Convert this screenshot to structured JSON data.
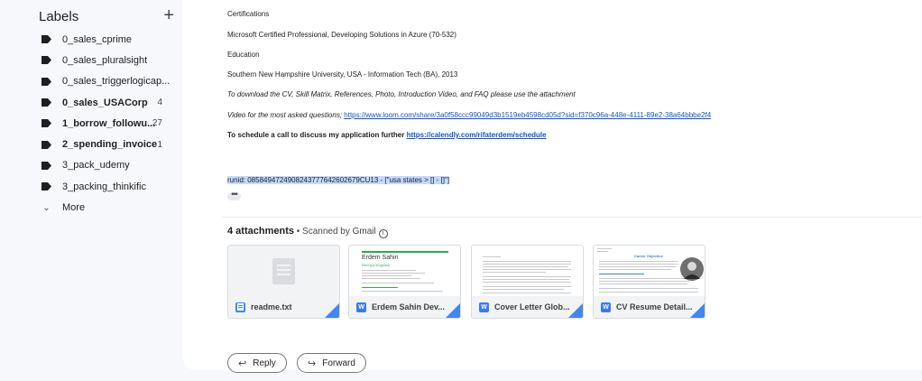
{
  "sidebar": {
    "labels_title": "Labels",
    "add_icon": "plus-icon",
    "items": [
      {
        "label": "0_sales_cprime",
        "count": "",
        "bold": false
      },
      {
        "label": "0_sales_pluralsight",
        "count": "",
        "bold": false
      },
      {
        "label": "0_sales_triggerlogicap...",
        "count": "",
        "bold": false
      },
      {
        "label": "0_sales_USACorp",
        "count": "4",
        "bold": true
      },
      {
        "label": "1_borrow_followu...",
        "count": "27",
        "bold": true
      },
      {
        "label": "2_spending_invoice",
        "count": "1",
        "bold": true
      },
      {
        "label": "3_pack_udemy",
        "count": "",
        "bold": false
      },
      {
        "label": "3_packing_thinkific",
        "count": "",
        "bold": false
      }
    ],
    "more": "More"
  },
  "email": {
    "certifications": "Certifications",
    "cert_item": "Microsoft Certified Professional, Developing Solutions in Azure (70-532)",
    "education": "Education",
    "edu_item": "Southern New Hampshire University, USA - Information Tech (BA), 2013",
    "download_note": "To download the CV, Skill Matrix, References, Photo, Introduction Video, and FAQ please use the attachment",
    "video_prefix": "Video for the most asked questions; ",
    "video_link": "https://www.loom.com/share/3a0f58ccc99049d3b1519eb4598cd05d?sid=f370c96a-448e-4111-89e2-38a64bbbe2f4",
    "schedule_prefix": "To schedule a call to discuss my application further ",
    "schedule_link": "https://calendly.com/rifaterdem/schedule",
    "runid": "runid: 0858494724908243777642602679CU13 - [\"usa states > [] - []\"]",
    "ellipsis": "•••"
  },
  "attachments": {
    "count_label": "4 attachments",
    "scanned": " • Scanned by Gmail ",
    "info": "i",
    "files": [
      {
        "name": "readme.txt",
        "icon": "doc-icon",
        "type": "text"
      },
      {
        "name": "Erdem Sahin Dev...",
        "icon": "word-icon",
        "type": "word"
      },
      {
        "name": "Cover Letter Glob...",
        "icon": "word-icon",
        "type": "word"
      },
      {
        "name": "CV Resume Detail...",
        "icon": "word-icon",
        "type": "word"
      }
    ],
    "preview_erdem_name": "Erdem Sahin",
    "preview_erdem_sub": "DevOps Engineer",
    "preview_cv_title": "Career Objective",
    "word_letter": "W"
  },
  "actions": {
    "reply": "Reply",
    "forward": "Forward",
    "reply_icon": "↩",
    "forward_icon": "↪"
  },
  "colors": {
    "link": "#1155cc",
    "selection": "#c3dafd",
    "file_blue": "#4285f4",
    "preview_green": "#34a853"
  }
}
